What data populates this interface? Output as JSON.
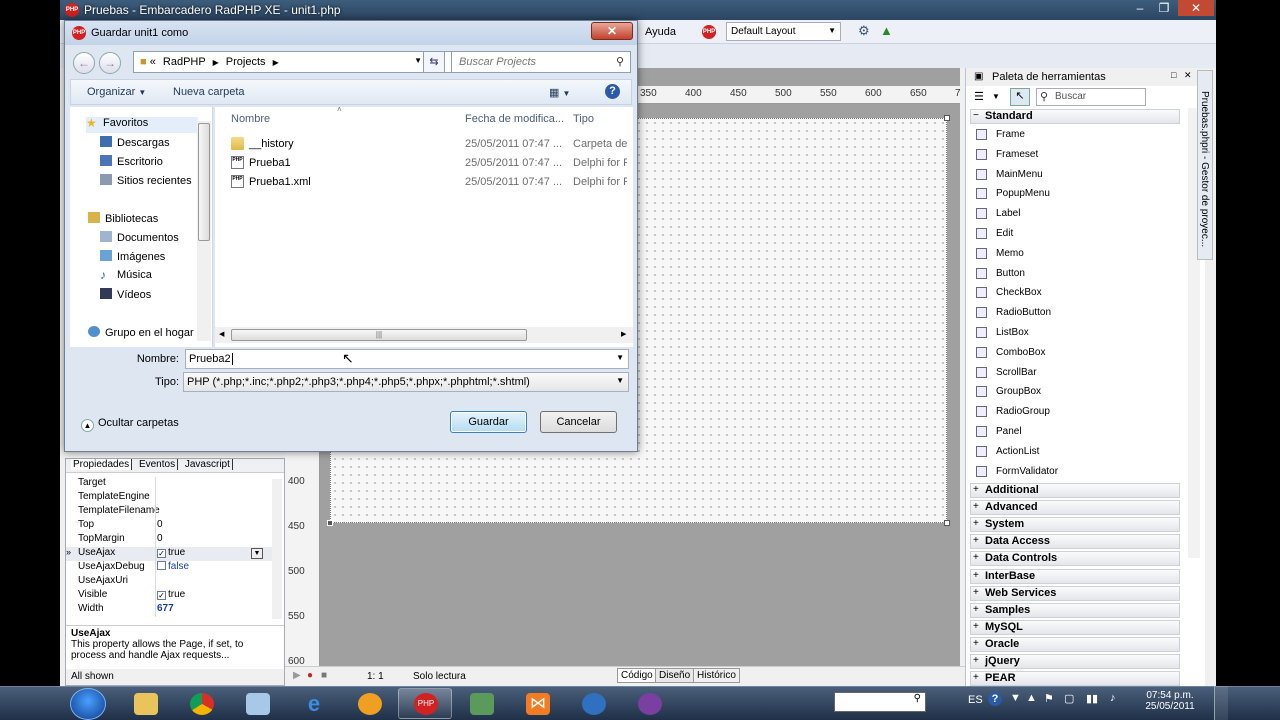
{
  "ide": {
    "title": "Pruebas - Embarcadero RadPHP XE - unit1.php",
    "menu_visible": [
      "Ayuda"
    ],
    "layout_select": "Default Layout",
    "ruler_top": [
      "350",
      "400",
      "450",
      "500",
      "550",
      "600",
      "650",
      "7"
    ],
    "ruler_left": [
      "400",
      "450",
      "500",
      "550",
      "600"
    ],
    "status": {
      "position": "1: 1",
      "mode": "Solo lectura",
      "tabs": [
        "Código",
        "Diseño",
        "Histórico"
      ]
    }
  },
  "props": {
    "tabs": [
      "Propiedades",
      "Eventos",
      "Javascript"
    ],
    "rows": [
      {
        "name": "Target",
        "value": ""
      },
      {
        "name": "TemplateEngine",
        "value": ""
      },
      {
        "name": "TemplateFilename",
        "value": ""
      },
      {
        "name": "Top",
        "value": "0"
      },
      {
        "name": "TopMargin",
        "value": "0"
      },
      {
        "name": "UseAjax",
        "value": "true"
      },
      {
        "name": "UseAjaxDebug",
        "value": "false"
      },
      {
        "name": "UseAjaxUri",
        "value": ""
      },
      {
        "name": "Visible",
        "value": "true"
      },
      {
        "name": "Width",
        "value": "677"
      }
    ],
    "help_title": "UseAjax",
    "help_text": "This property allows the Page, if set, to process and handle Ajax requests...",
    "status": "All shown"
  },
  "palette": {
    "title": "Paleta de herramientas",
    "search_placeholder": "Buscar",
    "group": "Standard",
    "items": [
      "Frame",
      "Frameset",
      "MainMenu",
      "PopupMenu",
      "Label",
      "Edit",
      "Memo",
      "Button",
      "CheckBox",
      "RadioButton",
      "ListBox",
      "ComboBox",
      "ScrollBar",
      "GroupBox",
      "RadioGroup",
      "Panel",
      "ActionList",
      "FormValidator"
    ],
    "categories": [
      "Additional",
      "Advanced",
      "System",
      "Data Access",
      "Data Controls",
      "InterBase",
      "Web Services",
      "Samples",
      "MySQL",
      "Oracle",
      "jQuery",
      "PEAR"
    ],
    "side_tab": "Pruebas.phpri - Gestor de proyec..."
  },
  "dialog": {
    "title": "Guardar unit1 como",
    "address": [
      "«",
      "RadPHP",
      "Projects"
    ],
    "search_placeholder": "Buscar Projects",
    "organize": "Organizar",
    "new_folder": "Nueva carpeta",
    "nav": {
      "favorites": "Favoritos",
      "fav_items": [
        "Descargas",
        "Escritorio",
        "Sitios recientes"
      ],
      "libraries": "Bibliotecas",
      "lib_items": [
        "Documentos",
        "Imágenes",
        "Música",
        "Vídeos"
      ],
      "homegroup": "Grupo en el hogar"
    },
    "columns": {
      "name": "Nombre",
      "date": "Fecha de modifica...",
      "type": "Tipo"
    },
    "files": [
      {
        "name": "__history",
        "date": "25/05/2011 07:47 ...",
        "type": "Carpeta de a"
      },
      {
        "name": "Prueba1",
        "date": "25/05/2011 07:47 ...",
        "type": "Delphi for Ph"
      },
      {
        "name": "Prueba1.xml",
        "date": "25/05/2011 07:47 ...",
        "type": "Delphi for Ph"
      }
    ],
    "name_label": "Nombre:",
    "name_value": "Prueba2",
    "type_label": "Tipo:",
    "type_value": "PHP (*.php;*.inc;*.php2;*.php3;*.php4;*.php5;*.phpx;*.phphtml;*.shtml)",
    "hide_folders": "Ocultar carpetas",
    "save": "Guardar",
    "cancel": "Cancelar"
  },
  "tray": {
    "lang": "ES",
    "time": "07:54 p.m.",
    "date": "25/05/2011"
  },
  "colors": {
    "accent": "#3c7fb1",
    "close": "#c4412d",
    "taskbar": "#1f3048"
  }
}
